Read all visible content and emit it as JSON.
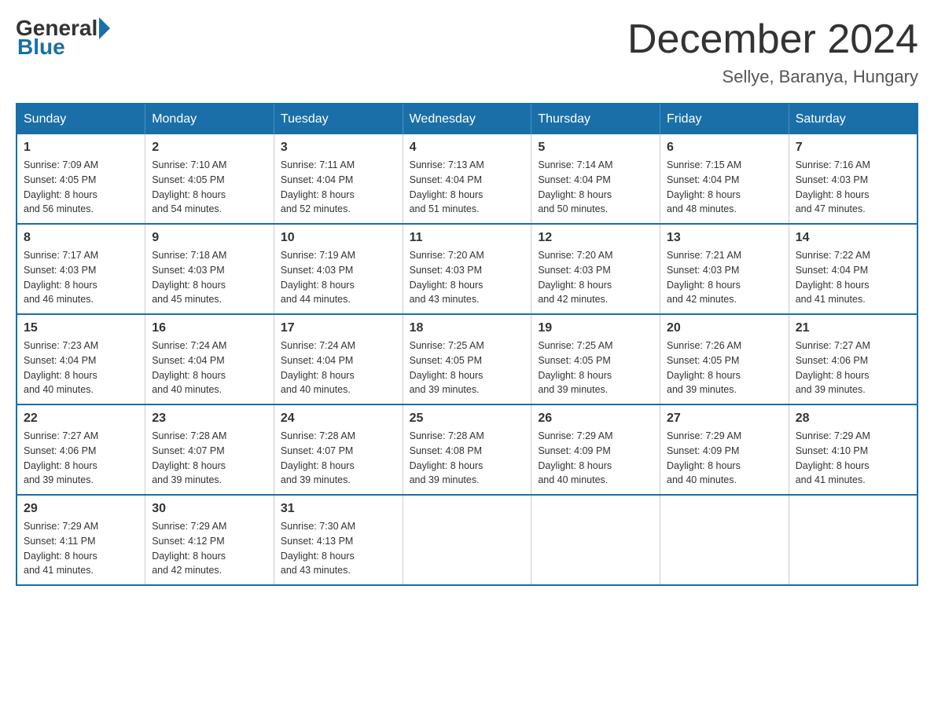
{
  "header": {
    "logo": {
      "general": "General",
      "blue": "Blue"
    },
    "title": "December 2024",
    "location": "Sellye, Baranya, Hungary"
  },
  "days_of_week": [
    "Sunday",
    "Monday",
    "Tuesday",
    "Wednesday",
    "Thursday",
    "Friday",
    "Saturday"
  ],
  "weeks": [
    [
      {
        "day": "1",
        "sunrise": "7:09 AM",
        "sunset": "4:05 PM",
        "daylight": "8 hours and 56 minutes."
      },
      {
        "day": "2",
        "sunrise": "7:10 AM",
        "sunset": "4:05 PM",
        "daylight": "8 hours and 54 minutes."
      },
      {
        "day": "3",
        "sunrise": "7:11 AM",
        "sunset": "4:04 PM",
        "daylight": "8 hours and 52 minutes."
      },
      {
        "day": "4",
        "sunrise": "7:13 AM",
        "sunset": "4:04 PM",
        "daylight": "8 hours and 51 minutes."
      },
      {
        "day": "5",
        "sunrise": "7:14 AM",
        "sunset": "4:04 PM",
        "daylight": "8 hours and 50 minutes."
      },
      {
        "day": "6",
        "sunrise": "7:15 AM",
        "sunset": "4:04 PM",
        "daylight": "8 hours and 48 minutes."
      },
      {
        "day": "7",
        "sunrise": "7:16 AM",
        "sunset": "4:03 PM",
        "daylight": "8 hours and 47 minutes."
      }
    ],
    [
      {
        "day": "8",
        "sunrise": "7:17 AM",
        "sunset": "4:03 PM",
        "daylight": "8 hours and 46 minutes."
      },
      {
        "day": "9",
        "sunrise": "7:18 AM",
        "sunset": "4:03 PM",
        "daylight": "8 hours and 45 minutes."
      },
      {
        "day": "10",
        "sunrise": "7:19 AM",
        "sunset": "4:03 PM",
        "daylight": "8 hours and 44 minutes."
      },
      {
        "day": "11",
        "sunrise": "7:20 AM",
        "sunset": "4:03 PM",
        "daylight": "8 hours and 43 minutes."
      },
      {
        "day": "12",
        "sunrise": "7:20 AM",
        "sunset": "4:03 PM",
        "daylight": "8 hours and 42 minutes."
      },
      {
        "day": "13",
        "sunrise": "7:21 AM",
        "sunset": "4:03 PM",
        "daylight": "8 hours and 42 minutes."
      },
      {
        "day": "14",
        "sunrise": "7:22 AM",
        "sunset": "4:04 PM",
        "daylight": "8 hours and 41 minutes."
      }
    ],
    [
      {
        "day": "15",
        "sunrise": "7:23 AM",
        "sunset": "4:04 PM",
        "daylight": "8 hours and 40 minutes."
      },
      {
        "day": "16",
        "sunrise": "7:24 AM",
        "sunset": "4:04 PM",
        "daylight": "8 hours and 40 minutes."
      },
      {
        "day": "17",
        "sunrise": "7:24 AM",
        "sunset": "4:04 PM",
        "daylight": "8 hours and 40 minutes."
      },
      {
        "day": "18",
        "sunrise": "7:25 AM",
        "sunset": "4:05 PM",
        "daylight": "8 hours and 39 minutes."
      },
      {
        "day": "19",
        "sunrise": "7:25 AM",
        "sunset": "4:05 PM",
        "daylight": "8 hours and 39 minutes."
      },
      {
        "day": "20",
        "sunrise": "7:26 AM",
        "sunset": "4:05 PM",
        "daylight": "8 hours and 39 minutes."
      },
      {
        "day": "21",
        "sunrise": "7:27 AM",
        "sunset": "4:06 PM",
        "daylight": "8 hours and 39 minutes."
      }
    ],
    [
      {
        "day": "22",
        "sunrise": "7:27 AM",
        "sunset": "4:06 PM",
        "daylight": "8 hours and 39 minutes."
      },
      {
        "day": "23",
        "sunrise": "7:28 AM",
        "sunset": "4:07 PM",
        "daylight": "8 hours and 39 minutes."
      },
      {
        "day": "24",
        "sunrise": "7:28 AM",
        "sunset": "4:07 PM",
        "daylight": "8 hours and 39 minutes."
      },
      {
        "day": "25",
        "sunrise": "7:28 AM",
        "sunset": "4:08 PM",
        "daylight": "8 hours and 39 minutes."
      },
      {
        "day": "26",
        "sunrise": "7:29 AM",
        "sunset": "4:09 PM",
        "daylight": "8 hours and 40 minutes."
      },
      {
        "day": "27",
        "sunrise": "7:29 AM",
        "sunset": "4:09 PM",
        "daylight": "8 hours and 40 minutes."
      },
      {
        "day": "28",
        "sunrise": "7:29 AM",
        "sunset": "4:10 PM",
        "daylight": "8 hours and 41 minutes."
      }
    ],
    [
      {
        "day": "29",
        "sunrise": "7:29 AM",
        "sunset": "4:11 PM",
        "daylight": "8 hours and 41 minutes."
      },
      {
        "day": "30",
        "sunrise": "7:29 AM",
        "sunset": "4:12 PM",
        "daylight": "8 hours and 42 minutes."
      },
      {
        "day": "31",
        "sunrise": "7:30 AM",
        "sunset": "4:13 PM",
        "daylight": "8 hours and 43 minutes."
      },
      null,
      null,
      null,
      null
    ]
  ],
  "labels": {
    "sunrise": "Sunrise:",
    "sunset": "Sunset:",
    "daylight": "Daylight:"
  }
}
